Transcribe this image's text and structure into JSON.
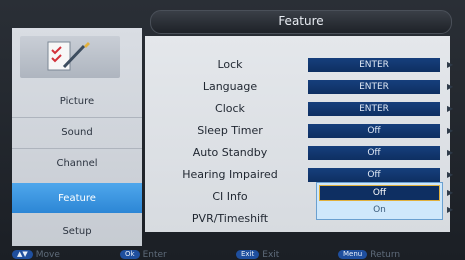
{
  "header": {
    "title": "Feature"
  },
  "nav": [
    {
      "label": "Picture",
      "active": false
    },
    {
      "label": "Sound",
      "active": false
    },
    {
      "label": "Channel",
      "active": false
    },
    {
      "label": "Feature",
      "active": true
    },
    {
      "label": "Setup",
      "active": false
    }
  ],
  "rows": [
    {
      "label": "Lock",
      "value": "ENTER"
    },
    {
      "label": "Language",
      "value": "ENTER"
    },
    {
      "label": "Clock",
      "value": "ENTER"
    },
    {
      "label": "Sleep Timer",
      "value": "Off"
    },
    {
      "label": "Auto Standby",
      "value": "Off"
    },
    {
      "label": "Hearing Impaired",
      "value": "Off"
    },
    {
      "label": "CI Info",
      "value": ""
    },
    {
      "label": "PVR/Timeshift",
      "value": ""
    }
  ],
  "dropdown": {
    "options": [
      "Off",
      "On"
    ],
    "selected": "Off"
  },
  "footer": [
    {
      "key": "▲▼",
      "label": "Move"
    },
    {
      "key": "Ok",
      "label": "Enter"
    },
    {
      "key": "Exit",
      "label": "Exit"
    },
    {
      "key": "Menu",
      "label": "Return"
    }
  ],
  "colors": {
    "accent": "#2c86d5",
    "value_bg": "#0e2f62",
    "highlight_border": "#e1b03b"
  }
}
